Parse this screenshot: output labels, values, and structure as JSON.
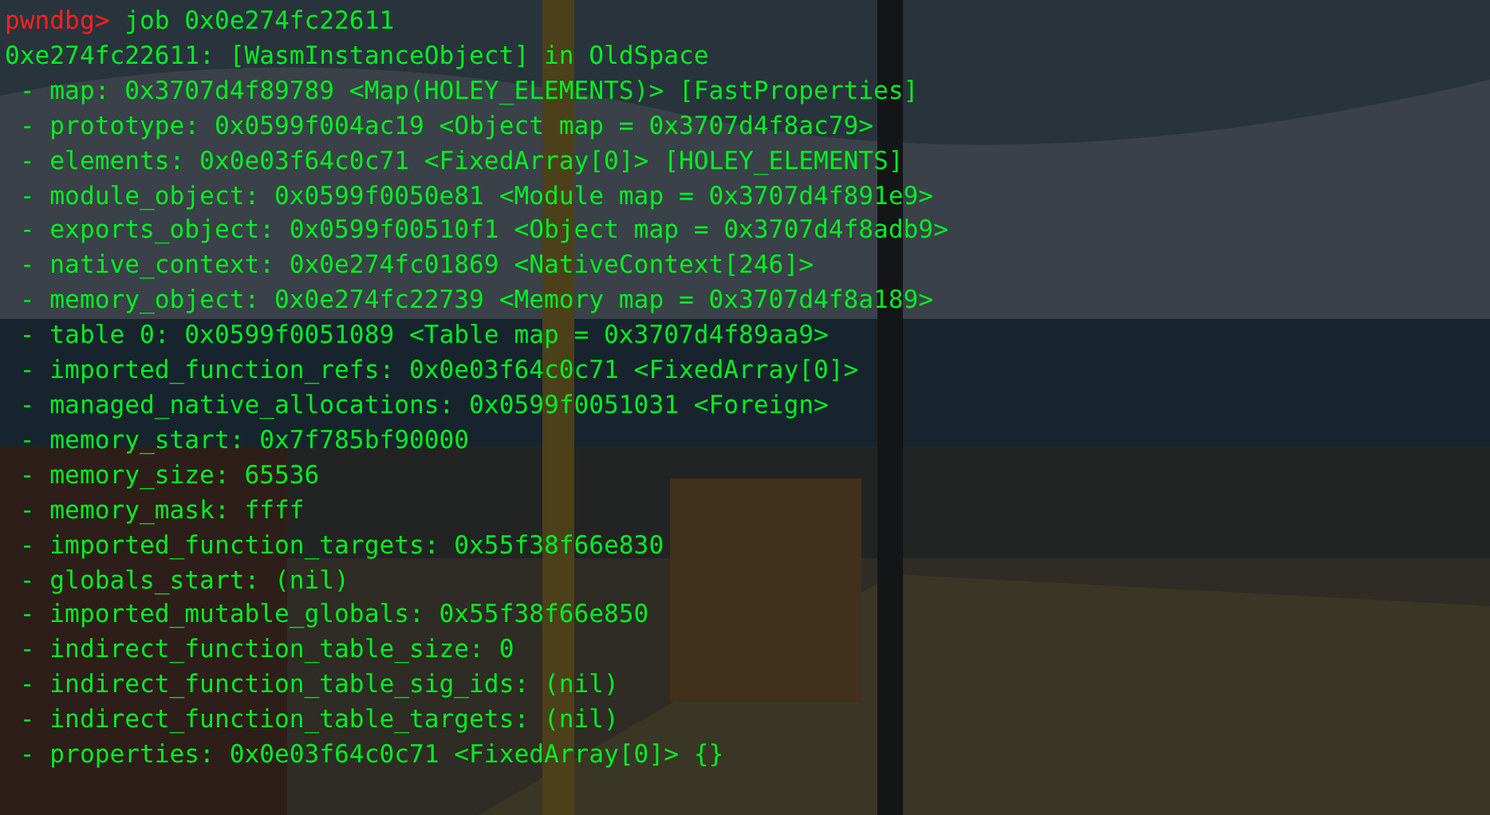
{
  "terminal": {
    "prompt": "pwndbg>",
    "command": "job 0x0e274fc22611",
    "output_header": "0xe274fc22611: [WasmInstanceObject] in OldSpace",
    "output_lines": [
      "- map: 0x3707d4f89789 <Map(HOLEY_ELEMENTS)> [FastProperties]",
      "- prototype: 0x0599f004ac19 <Object map = 0x3707d4f8ac79>",
      "- elements: 0x0e03f64c0c71 <FixedArray[0]> [HOLEY_ELEMENTS]",
      "- module_object: 0x0599f0050e81 <Module map = 0x3707d4f891e9>",
      "- exports_object: 0x0599f00510f1 <Object map = 0x3707d4f8adb9>",
      "- native_context: 0x0e274fc01869 <NativeContext[246]>",
      "- memory_object: 0x0e274fc22739 <Memory map = 0x3707d4f8a189>",
      "- table 0: 0x0599f0051089 <Table map = 0x3707d4f89aa9>",
      "- imported_function_refs: 0x0e03f64c0c71 <FixedArray[0]>",
      "- managed_native_allocations: 0x0599f0051031 <Foreign>",
      "- memory_start: 0x7f785bf90000",
      "- memory_size: 65536",
      "- memory_mask: ffff",
      "- imported_function_targets: 0x55f38f66e830",
      "- globals_start: (nil)",
      "- imported_mutable_globals: 0x55f38f66e850",
      "- indirect_function_table_size: 0",
      "- indirect_function_table_sig_ids: (nil)",
      "- indirect_function_table_targets: (nil)",
      "- properties: 0x0e03f64c0c71 <FixedArray[0]> {}"
    ]
  }
}
